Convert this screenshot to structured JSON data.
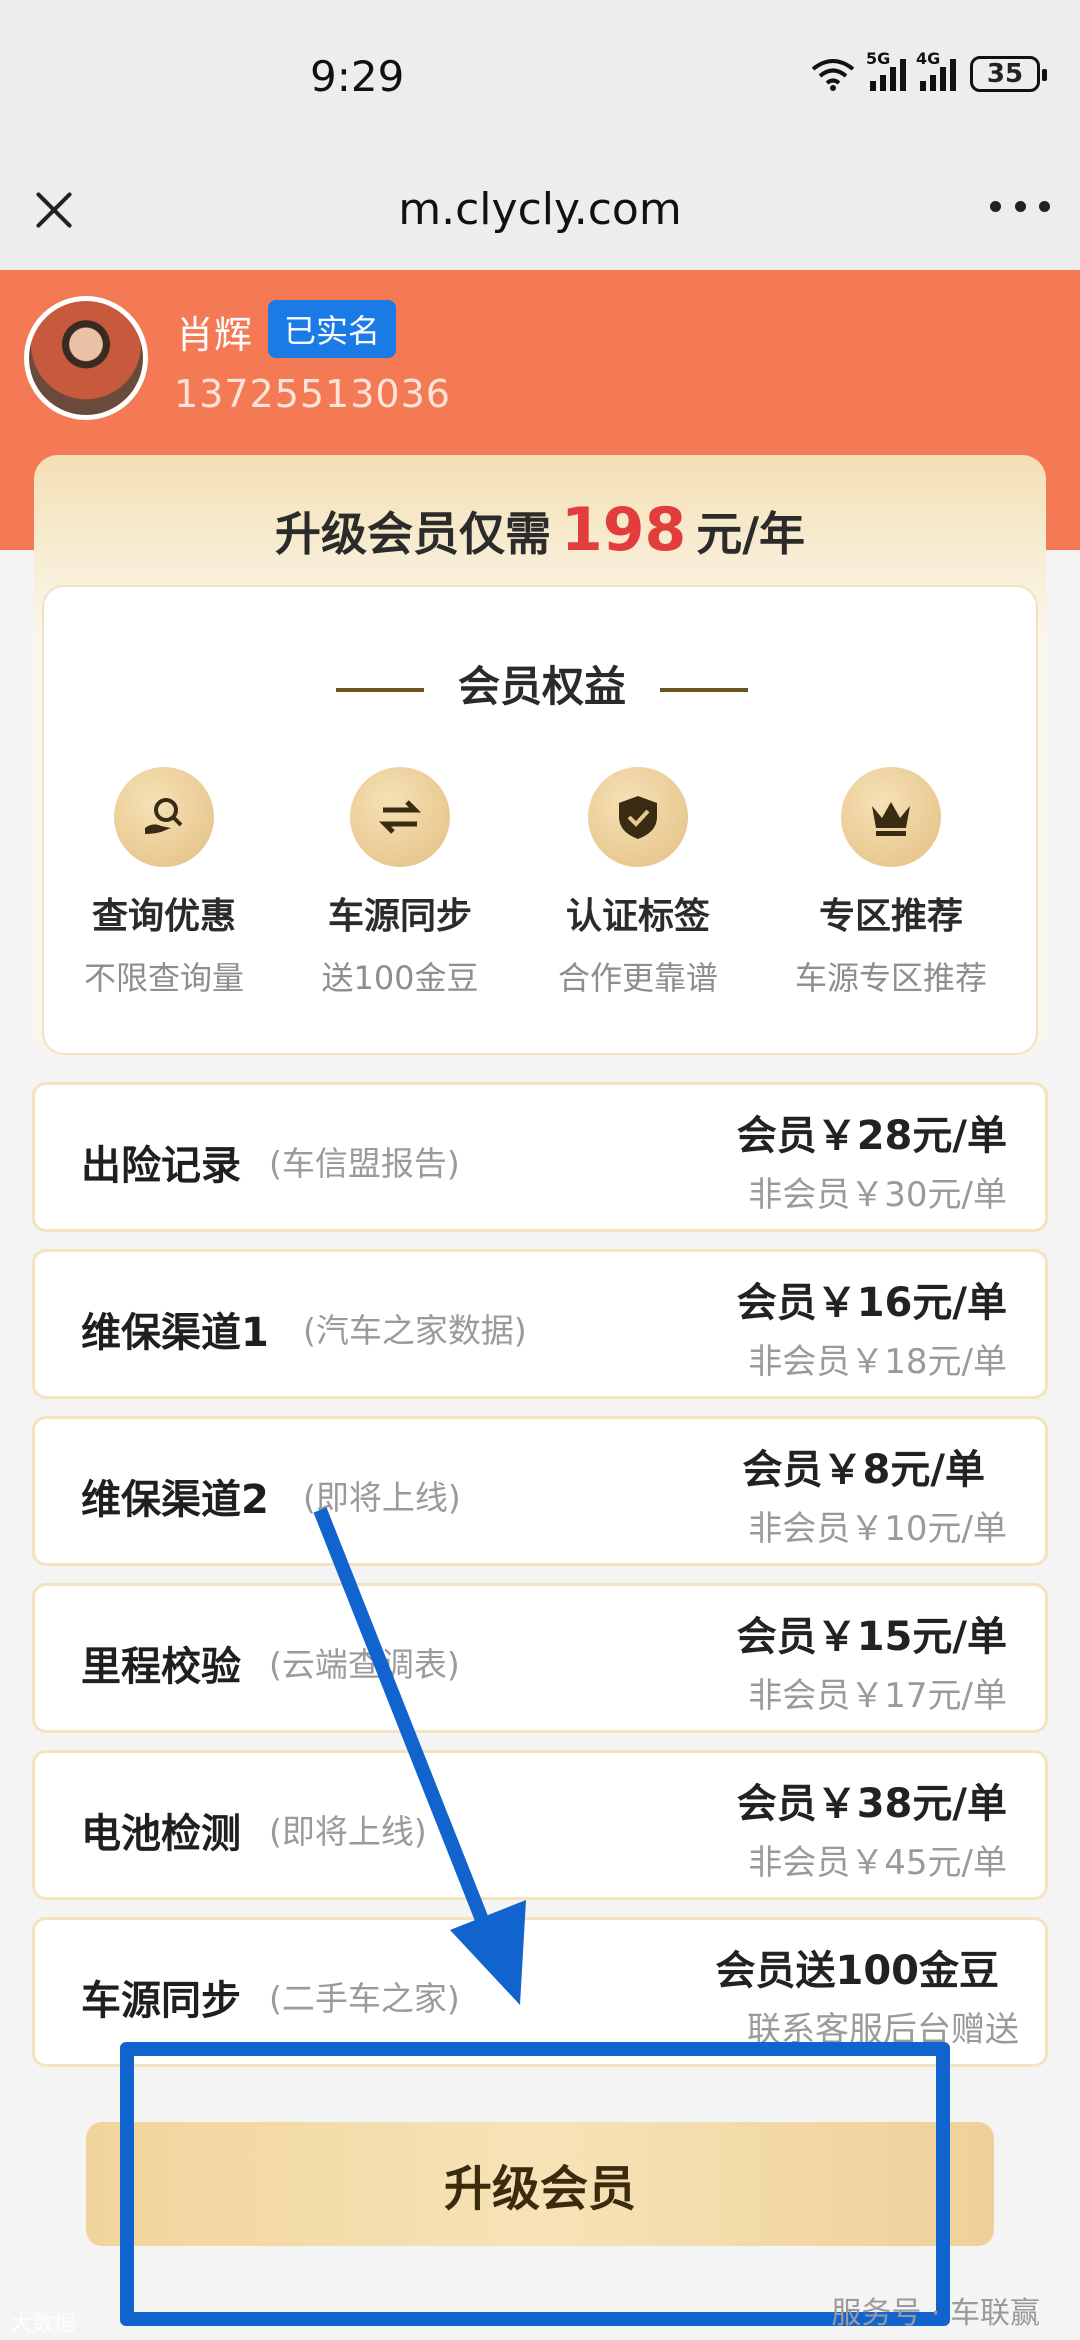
{
  "status_bar": {
    "time": "9:29",
    "battery": "35",
    "sig1_label": "5G",
    "sig2_label": "4G"
  },
  "browser": {
    "url": "m.clycly.com"
  },
  "user": {
    "name": "肖辉",
    "badge": "已实名",
    "phone": "13725513036"
  },
  "promo": {
    "prefix": "升级会员仅需",
    "price": "198",
    "suffix": "元/年"
  },
  "benefits": {
    "title": "会员权益",
    "items": [
      {
        "title": "查询优惠",
        "subtitle": "不限查询量",
        "icon": "search-hand-icon"
      },
      {
        "title": "车源同步",
        "subtitle": "送100金豆",
        "icon": "sync-arrows-icon"
      },
      {
        "title": "认证标签",
        "subtitle": "合作更靠谱",
        "icon": "shield-check-icon"
      },
      {
        "title": "专区推荐",
        "subtitle": "车源专区推荐",
        "icon": "crown-icon"
      }
    ]
  },
  "services": [
    {
      "name": "出险记录",
      "note": "(车信盟报告)",
      "member_price": "会员￥28元/单",
      "nonmember_price": "非会员￥30元/单"
    },
    {
      "name": "维保渠道1",
      "note": "(汽车之家数据)",
      "member_price": "会员￥16元/单",
      "nonmember_price": "非会员￥18元/单"
    },
    {
      "name": "维保渠道2",
      "note": "(即将上线)",
      "member_price": "会员￥8元/单",
      "nonmember_price": "非会员￥10元/单"
    },
    {
      "name": "里程校验",
      "note": "(云端查调表)",
      "member_price": "会员￥15元/单",
      "nonmember_price": "非会员￥17元/单"
    },
    {
      "name": "电池检测",
      "note": "(即将上线)",
      "member_price": "会员￥38元/单",
      "nonmember_price": "非会员￥45元/单"
    },
    {
      "name": "车源同步",
      "note": "(二手车之家)",
      "member_price": "会员送100金豆",
      "nonmember_price": "联系客服后台赠送"
    }
  ],
  "upgrade_button": "升级会员",
  "watermarks": {
    "left": "大数据",
    "right": "服务号 · 车联赢"
  },
  "colors": {
    "header": "#f47a55",
    "badge": "#1a7be6",
    "price": "#e33c3c",
    "annotation": "#1164cd"
  }
}
